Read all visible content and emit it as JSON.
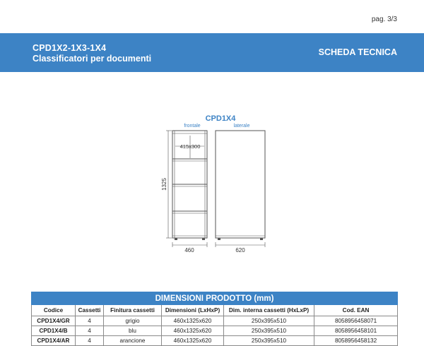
{
  "page": {
    "number": "pag. 3/3"
  },
  "header": {
    "code": "CPD1X2-1X3-1X4",
    "subtitle": "Classificatori per documenti",
    "sheet_label": "SCHEDA TECNICA",
    "color": "#3d83c5"
  },
  "drawing": {
    "title": "CPD1X4",
    "front_label": "frontale",
    "side_label": "laterale",
    "drawer_inner_dim": "415x300",
    "height_dim": "1325",
    "width_dim": "460",
    "depth_dim": "620",
    "line_color": "#555555",
    "title_color": "#3d83c5"
  },
  "table": {
    "title": "DIMENSIONI PRODOTTO (mm)",
    "headers": [
      "Codice",
      "Cassetti",
      "Finitura cassetti",
      "Dimensioni (LxHxP)",
      "Dim. interna cassetti (HxLxP)",
      "Cod. EAN"
    ],
    "rows": [
      {
        "code": "CPD1X4/GR",
        "drawers": "4",
        "finish": "grigio",
        "dimensions": "460x1325x620",
        "inner": "250x395x510",
        "ean": "8058956458071"
      },
      {
        "code": "CPD1X4/B",
        "drawers": "4",
        "finish": "blu",
        "dimensions": "460x1325x620",
        "inner": "250x395x510",
        "ean": "8058956458101"
      },
      {
        "code": "CPD1X4/AR",
        "drawers": "4",
        "finish": "arancione",
        "dimensions": "460x1325x620",
        "inner": "250x395x510",
        "ean": "8058956458132"
      }
    ]
  }
}
